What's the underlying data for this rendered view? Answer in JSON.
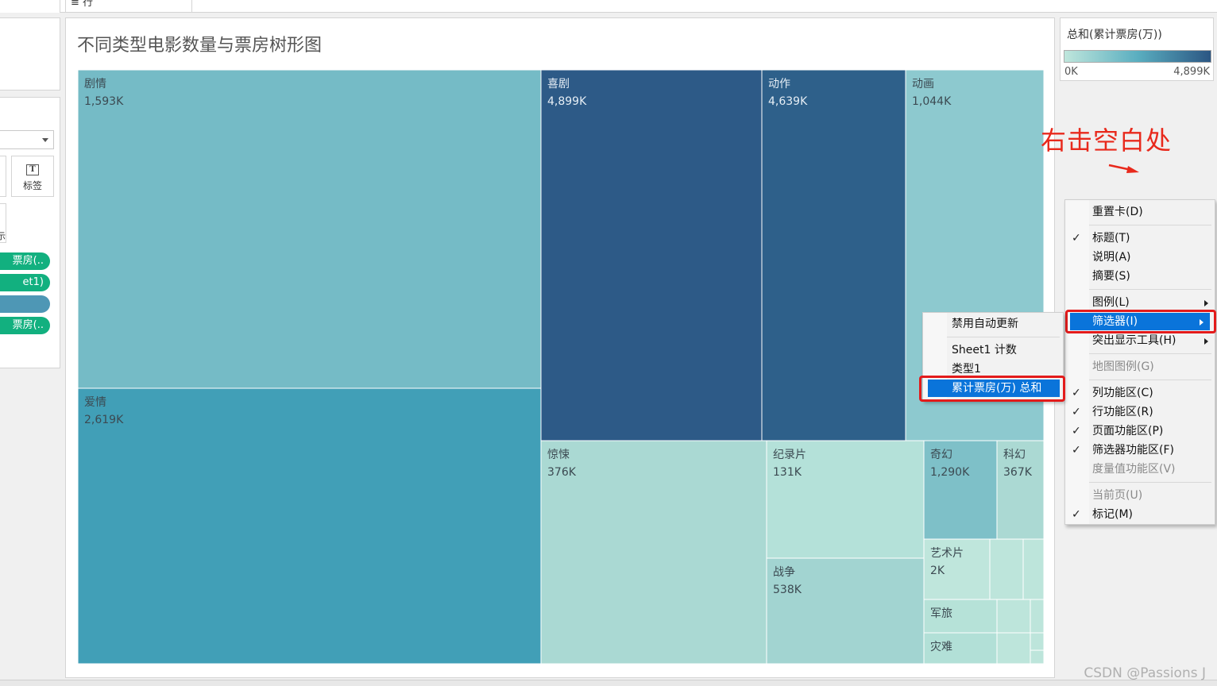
{
  "toolbar": {
    "rows_label": "≡ 行"
  },
  "left_panel": {
    "label_button": "标签",
    "partial_icon_char": "T",
    "partial_btn_text": "示",
    "pills": [
      {
        "text": "票房(..",
        "color": "#12b07f"
      },
      {
        "text": "et1)",
        "color": "#12b07f"
      },
      {
        "text": "",
        "color": "#4e97b5"
      },
      {
        "text": "票房(..",
        "color": "#12b07f"
      }
    ]
  },
  "sheet": {
    "title": "不同类型电影数量与票房树形图"
  },
  "chart_data": {
    "type": "treemap",
    "title": "不同类型电影数量与票房树形图",
    "value_label": "总和(累计票房(万))",
    "color_range": [
      "0K",
      "4,899K"
    ],
    "nodes": [
      {
        "name": "剧情",
        "value_label": "1,593K",
        "value": 1593,
        "color": "#75bbc6",
        "dark": false
      },
      {
        "name": "爱情",
        "value_label": "2,619K",
        "value": 2619,
        "color": "#419fb7",
        "dark": false
      },
      {
        "name": "喜剧",
        "value_label": "4,899K",
        "value": 4899,
        "color": "#2d5a87",
        "dark": true
      },
      {
        "name": "动作",
        "value_label": "4,639K",
        "value": 4639,
        "color": "#2e608a",
        "dark": true
      },
      {
        "name": "动画",
        "value_label": "1,044K",
        "value": 1044,
        "color": "#8dc9cf",
        "dark": false
      },
      {
        "name": "惊悚",
        "value_label": "376K",
        "value": 376,
        "color": "#aad9d3",
        "dark": false
      },
      {
        "name": "纪录片",
        "value_label": "131K",
        "value": 131,
        "color": "#b4e1d9",
        "dark": false
      },
      {
        "name": "战争",
        "value_label": "538K",
        "value": 538,
        "color": "#a2d4d1",
        "dark": false
      },
      {
        "name": "奇幻",
        "value_label": "1,290K",
        "value": 1290,
        "color": "#7ec0c8",
        "dark": false
      },
      {
        "name": "科幻",
        "value_label": "367K",
        "value": 367,
        "color": "#abd9d3",
        "dark": false
      },
      {
        "name": "艺术片",
        "value_label": "2K",
        "value": 2,
        "color": "#bfe6dc",
        "dark": false
      },
      {
        "name": "军旅",
        "value_label": "",
        "value": null,
        "color": "#b6e2d8",
        "dark": false
      },
      {
        "name": "灾难",
        "value_label": "",
        "value": null,
        "color": "#b2e0d7",
        "dark": false
      }
    ],
    "small_tiles_color": "#bde5db"
  },
  "legend": {
    "title": "总和(累计票房(万))",
    "min": "0K",
    "max": "4,899K",
    "ramp_from": "#bfe6dc",
    "ramp_to": "#2b5683"
  },
  "annotation": {
    "text": "右击空白处",
    "color": "#e8291c"
  },
  "context_menu": {
    "items": [
      {
        "id": "reset",
        "label": "重置卡(D)",
        "checked": false,
        "submenu": false,
        "disabled": false,
        "selected": false
      },
      {
        "id": "title",
        "label": "标题(T)",
        "checked": true,
        "submenu": false,
        "disabled": false,
        "selected": false
      },
      {
        "id": "caption",
        "label": "说明(A)",
        "checked": false,
        "submenu": false,
        "disabled": false,
        "selected": false
      },
      {
        "id": "summary",
        "label": "摘要(S)",
        "checked": false,
        "submenu": false,
        "disabled": false,
        "selected": false
      },
      {
        "id": "legend",
        "label": "图例(L)",
        "checked": false,
        "submenu": true,
        "disabled": false,
        "selected": false
      },
      {
        "id": "filter",
        "label": "筛选器(I)",
        "checked": false,
        "submenu": true,
        "disabled": false,
        "selected": true
      },
      {
        "id": "highlighter",
        "label": "突出显示工具(H)",
        "checked": false,
        "submenu": true,
        "disabled": false,
        "selected": false
      },
      {
        "id": "map-legend",
        "label": "地图图例(G)",
        "checked": false,
        "submenu": false,
        "disabled": true,
        "selected": false
      },
      {
        "id": "columns-shelf",
        "label": "列功能区(C)",
        "checked": true,
        "submenu": false,
        "disabled": false,
        "selected": false
      },
      {
        "id": "rows-shelf",
        "label": "行功能区(R)",
        "checked": true,
        "submenu": false,
        "disabled": false,
        "selected": false
      },
      {
        "id": "pages-shelf",
        "label": "页面功能区(P)",
        "checked": true,
        "submenu": false,
        "disabled": false,
        "selected": false
      },
      {
        "id": "filters-shelf",
        "label": "筛选器功能区(F)",
        "checked": true,
        "submenu": false,
        "disabled": false,
        "selected": false
      },
      {
        "id": "measure-values",
        "label": "度量值功能区(V)",
        "checked": false,
        "submenu": false,
        "disabled": true,
        "selected": false
      },
      {
        "id": "current-page",
        "label": "当前页(U)",
        "checked": false,
        "submenu": false,
        "disabled": true,
        "selected": false
      },
      {
        "id": "marks",
        "label": "标记(M)",
        "checked": true,
        "submenu": false,
        "disabled": false,
        "selected": false
      }
    ]
  },
  "filter_submenu": {
    "items": [
      {
        "id": "disable-auto-update",
        "label": "禁用自动更新",
        "selected": false
      },
      {
        "id": "sheet1-count",
        "label": "Sheet1 计数",
        "selected": false
      },
      {
        "id": "type1",
        "label": "类型1",
        "selected": false
      },
      {
        "id": "box-office-sum",
        "label": "累计票房(万) 总和",
        "selected": true
      }
    ]
  },
  "watermark": {
    "text": "CSDN @Passions J"
  }
}
